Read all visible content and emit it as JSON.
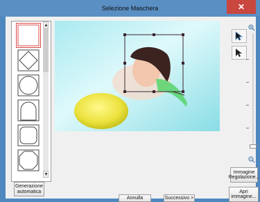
{
  "window": {
    "title": "Selezione Maschera",
    "close_glyph": "✕",
    "accent": "#4f87bf"
  },
  "shape_list": {
    "scroll_up": "▲",
    "scroll_down": "▼",
    "items": [
      {
        "name": "rectangle-shape",
        "selected": true
      },
      {
        "name": "diamond-shape",
        "selected": false
      },
      {
        "name": "circle-shape",
        "selected": false
      },
      {
        "name": "arch-shape",
        "selected": false
      },
      {
        "name": "rounded-rectangle-shape",
        "selected": false
      },
      {
        "name": "octagon-shape",
        "selected": false
      }
    ]
  },
  "tools": {
    "select_icon": "arrow-cursor-icon",
    "move_icon": "arrow-pointer-icon",
    "zoom_in_icon": "zoom-in-icon",
    "zoom_out_icon": "zoom-out-icon"
  },
  "buttons": {
    "auto_generation": "Generazione automatica",
    "image_adjustment": "Immagine Regolazione...",
    "cancel": "Annulla",
    "next": "Successivo >",
    "open_image": "Apri immagine..."
  }
}
